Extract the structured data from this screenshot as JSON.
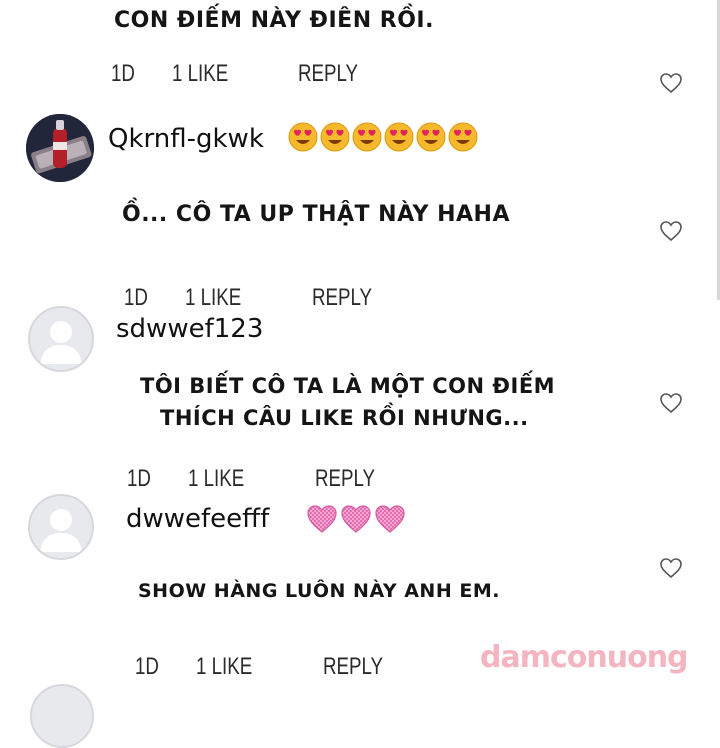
{
  "comments": [
    {
      "text_lines": [
        "CON ĐIẾM NÀY ĐIÊN RỒI."
      ],
      "meta": {
        "age": "1D",
        "likes": "1 LIKE",
        "reply": "REPLY"
      }
    },
    {
      "username": "Qkrnfl-gkwk",
      "text_lines": [
        "Ồ... CÔ TA UP THẬT NÀY HAHA"
      ],
      "meta": {
        "age": "1D",
        "likes": "1 LIKE",
        "reply": "REPLY"
      }
    },
    {
      "username": "sdwwef123",
      "text_lines": [
        "TÔI BIẾT CÔ TA LÀ MỘT CON ĐIẾM",
        "THÍCH CÂU LIKE RỒI NHƯNG..."
      ],
      "meta": {
        "age": "1D",
        "likes": "1 LIKE",
        "reply": "REPLY"
      }
    },
    {
      "username": "dwwefeefff",
      "text_lines": [
        "SHOW HÀNG LUÔN NÀY ANH EM."
      ],
      "meta": {
        "age": "1D",
        "likes": "1 LIKE",
        "reply": "REPLY"
      }
    }
  ],
  "watermark": "damconuong",
  "icons": {
    "heart": "heart-outline-icon",
    "emoji_heart_eyes": "heart-eyes-emoji",
    "emoji_pink_heart": "pink-heart-emoji"
  },
  "colors": {
    "icon_stroke": "#555555",
    "emoji_face": "#f5b92b",
    "emoji_heart": "#e0245e",
    "pink_heart": "#f78fc4",
    "avatar_bg": "#e8e9ed"
  }
}
